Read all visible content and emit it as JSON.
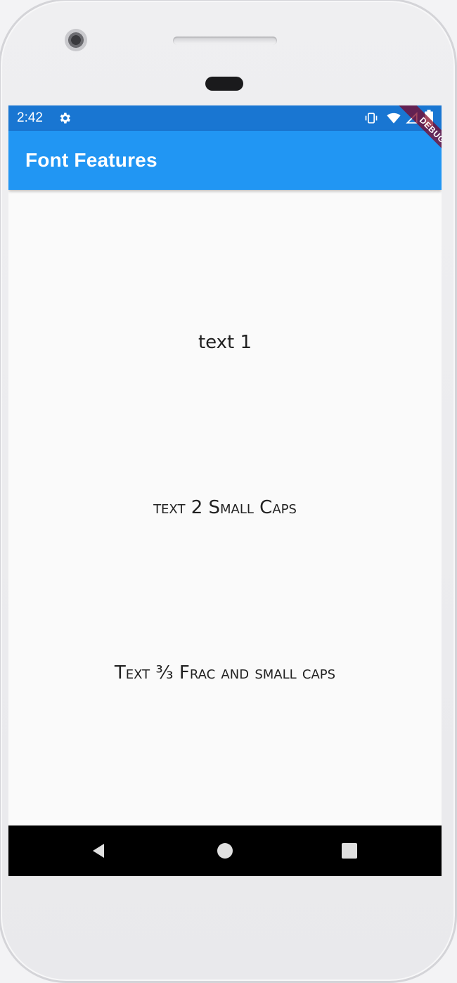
{
  "status_bar": {
    "time": "2:42",
    "icons": [
      "gear-icon",
      "vibrate-icon",
      "wifi-icon",
      "signal-icon",
      "battery-icon"
    ],
    "background_color": "#1976d2"
  },
  "app_bar": {
    "title": "Font Features",
    "background_color": "#2196f3",
    "debug_banner": "DEBUG"
  },
  "content": {
    "text1": "text 1",
    "text2": "text 2 Small Caps",
    "text3": "Text ³⁄₃ Frac and small caps"
  },
  "nav_bar": {
    "icons": [
      "back-icon",
      "home-icon",
      "recents-icon"
    ]
  }
}
